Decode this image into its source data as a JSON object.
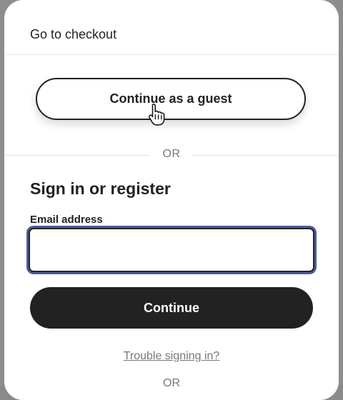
{
  "modal": {
    "title": "Go to checkout",
    "guest_button_label": "Continue as a guest",
    "divider_text": "OR",
    "section_heading": "Sign in or register",
    "email_label": "Email address",
    "email_value": "",
    "email_placeholder": "",
    "continue_button_label": "Continue",
    "trouble_link_text": "Trouble signing in?",
    "bottom_divider_text": "OR"
  },
  "colors": {
    "primary_text": "#222222",
    "button_dark": "#222222",
    "muted_text": "#777777",
    "focus_ring": "#4c5b9b"
  },
  "icons": {
    "cursor": "hand-pointer-icon"
  }
}
